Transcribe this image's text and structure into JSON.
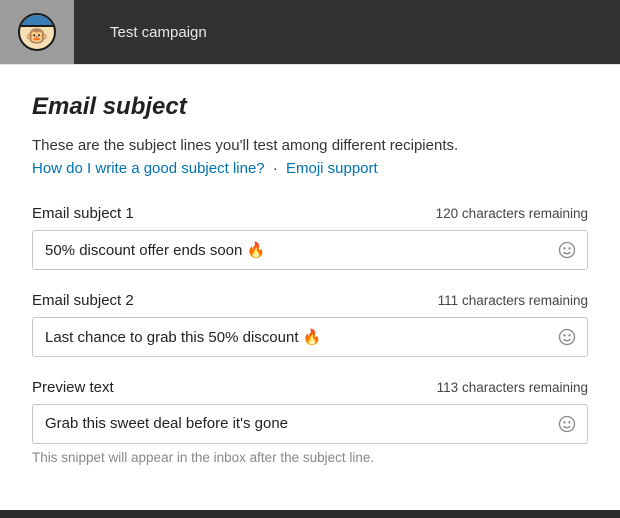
{
  "header": {
    "campaign_name": "Test campaign"
  },
  "section": {
    "title": "Email subject",
    "description": "These are the subject lines you'll test among different recipients.",
    "link_subject_tips": "How do I write a good subject line?",
    "link_emoji": "Emoji support",
    "link_separator": "·"
  },
  "fields": {
    "subject1": {
      "label": "Email subject 1",
      "remaining": "120 characters remaining",
      "value": "50% discount offer ends soon 🔥"
    },
    "subject2": {
      "label": "Email subject 2",
      "remaining": "111 characters remaining",
      "value": "Last chance to grab this 50% discount 🔥"
    },
    "preview": {
      "label": "Preview text",
      "remaining": "113 characters remaining",
      "value": "Grab this sweet deal before it's gone",
      "hint": "This snippet will appear in the inbox after the subject line."
    }
  }
}
